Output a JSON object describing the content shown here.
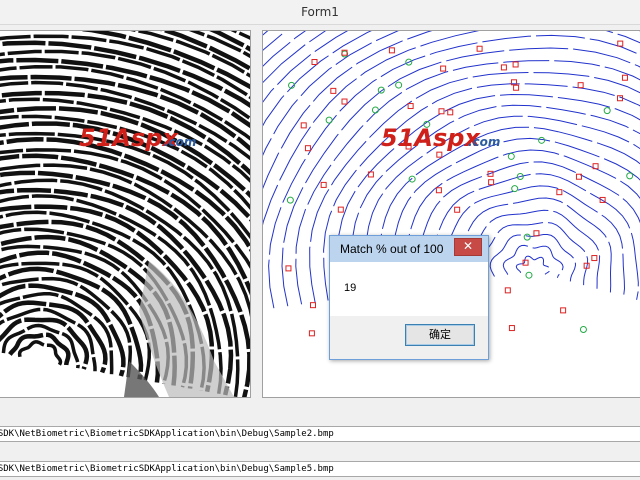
{
  "window": {
    "title": "Form1"
  },
  "left_panel": {
    "watermark_main": "51Aspx",
    "watermark_suffix": ".com"
  },
  "right_panel": {
    "watermark_main": "51Aspx",
    "watermark_suffix": ".com"
  },
  "paths": {
    "first": "rcSDK\\NetBiometric\\BiometricSDKApplication\\bin\\Debug\\Sample2.bmp",
    "second": "rcSDK\\NetBiometric\\BiometricSDKApplication\\bin\\Debug\\Sample5.bmp"
  },
  "dialog": {
    "title": "Match % out of 100",
    "close_glyph": "✕",
    "message": "19",
    "ok_label": "确定"
  },
  "colors": {
    "ridge_line": "#2233cc",
    "minutia_square": "#dd2222",
    "minutia_circle": "#22aa44",
    "fingerprint_dark": "#111111"
  }
}
